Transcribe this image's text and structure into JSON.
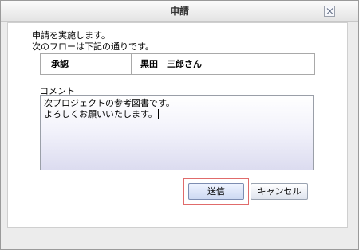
{
  "dialog": {
    "title": "申請",
    "close_icon": "close-icon"
  },
  "message": {
    "line1": "申請を実施します。",
    "line2": "次のフローは下記の通りです。"
  },
  "flow": {
    "label": "承認",
    "value": "黒田　三郎さん"
  },
  "comment": {
    "label": "コメント",
    "lines": [
      "次プロジェクトの参考図書です。",
      "よろしくお願いいたします。"
    ]
  },
  "buttons": {
    "send": "送信",
    "cancel": "キャンセル"
  },
  "colors": {
    "highlight": "#e06b6b"
  }
}
